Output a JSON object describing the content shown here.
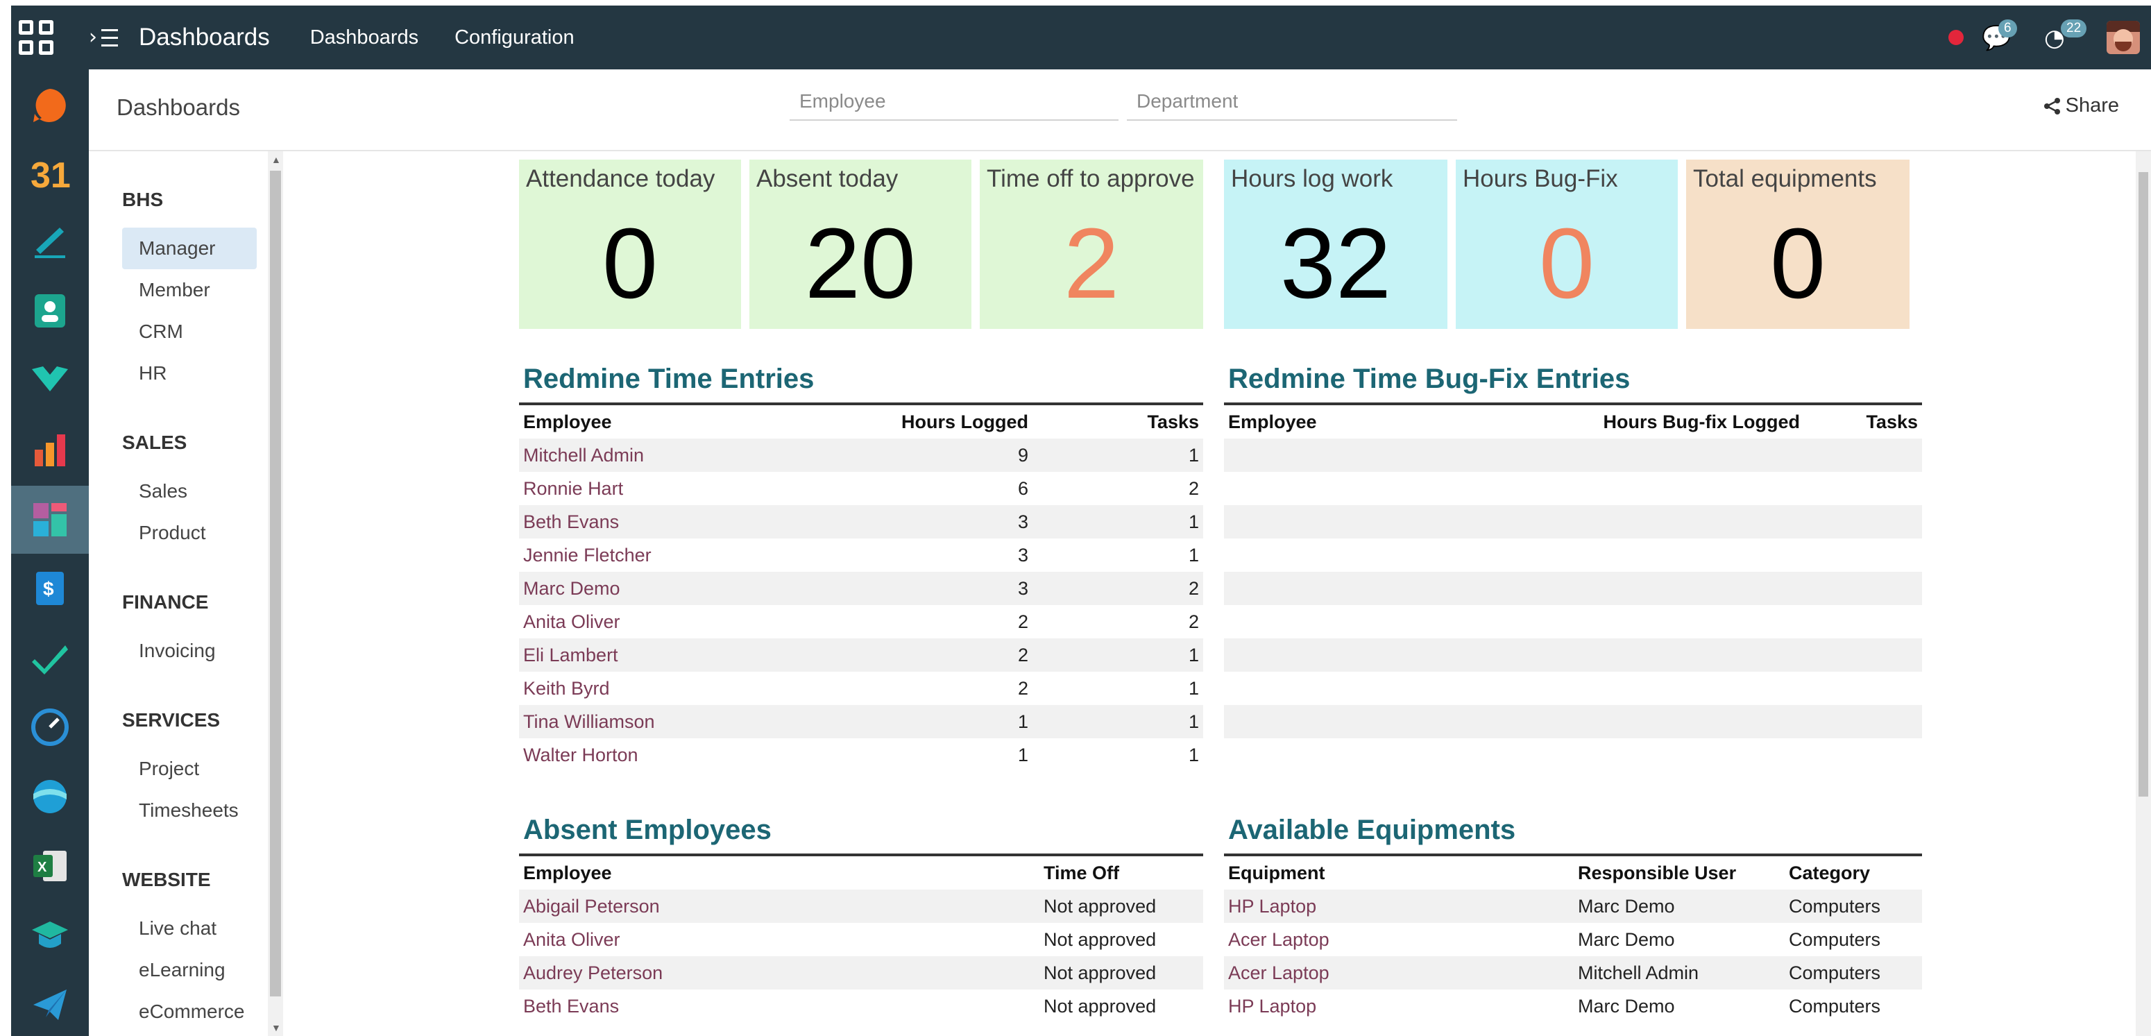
{
  "topbar": {
    "brand": "Dashboards",
    "nav": [
      "Dashboards",
      "Configuration"
    ],
    "messages_count": "6",
    "activities_count": "22"
  },
  "controlbar": {
    "breadcrumb": "Dashboards",
    "employee_placeholder": "Employee",
    "department_placeholder": "Department",
    "share_label": "Share"
  },
  "sidemenu": {
    "sections": [
      {
        "title": "BHS",
        "items": [
          "Manager",
          "Member",
          "CRM",
          "HR"
        ]
      },
      {
        "title": "SALES",
        "items": [
          "Sales",
          "Product"
        ]
      },
      {
        "title": "FINANCE",
        "items": [
          "Invoicing"
        ]
      },
      {
        "title": "SERVICES",
        "items": [
          "Project",
          "Timesheets"
        ]
      },
      {
        "title": "WEBSITE",
        "items": [
          "Live chat",
          "eLearning",
          "eCommerce"
        ]
      }
    ],
    "active_item": "Manager"
  },
  "kpis": [
    {
      "label": "Attendance today",
      "value": "0",
      "color": "#dff7d6"
    },
    {
      "label": "Absent today",
      "value": "20",
      "color": "#dff7d6"
    },
    {
      "label": "Time off to approve",
      "value": "2",
      "color": "#dff7d6"
    },
    {
      "label": "Hours log work",
      "value": "32",
      "color": "#c6f3f6"
    },
    {
      "label": "Hours Bug-Fix",
      "value": "0",
      "color": "#c6f3f6"
    },
    {
      "label": "Total equipments",
      "value": "0",
      "color": "#f6e0c8"
    }
  ],
  "redmine_time": {
    "title": "Redmine Time Entries",
    "headers": [
      "Employee",
      "Hours Logged",
      "Tasks"
    ],
    "rows": [
      [
        "Mitchell Admin",
        "9",
        "1"
      ],
      [
        "Ronnie Hart",
        "6",
        "2"
      ],
      [
        "Beth Evans",
        "3",
        "1"
      ],
      [
        "Jennie Fletcher",
        "3",
        "1"
      ],
      [
        "Marc Demo",
        "3",
        "2"
      ],
      [
        "Anita Oliver",
        "2",
        "2"
      ],
      [
        "Eli Lambert",
        "2",
        "1"
      ],
      [
        "Keith Byrd",
        "2",
        "1"
      ],
      [
        "Tina Williamson",
        "1",
        "1"
      ],
      [
        "Walter Horton",
        "1",
        "1"
      ]
    ]
  },
  "redmine_bugfix": {
    "title": "Redmine Time Bug-Fix Entries",
    "headers": [
      "Employee",
      "Hours Bug-fix Logged",
      "Tasks"
    ]
  },
  "absent": {
    "title": "Absent Employees",
    "headers": [
      "Employee",
      "Time Off"
    ],
    "rows": [
      [
        "Abigail Peterson",
        "Not approved"
      ],
      [
        "Anita Oliver",
        "Not approved"
      ],
      [
        "Audrey Peterson",
        "Not approved"
      ],
      [
        "Beth Evans",
        "Not approved"
      ]
    ]
  },
  "equipments": {
    "title": "Available Equipments",
    "headers": [
      "Equipment",
      "Responsible User",
      "Category"
    ],
    "rows": [
      [
        "HP Laptop",
        "Marc Demo",
        "Computers"
      ],
      [
        "Acer Laptop",
        "Marc Demo",
        "Computers"
      ],
      [
        "Acer Laptop",
        "Mitchell Admin",
        "Computers"
      ],
      [
        "HP Laptop",
        "Marc Demo",
        "Computers"
      ]
    ]
  }
}
